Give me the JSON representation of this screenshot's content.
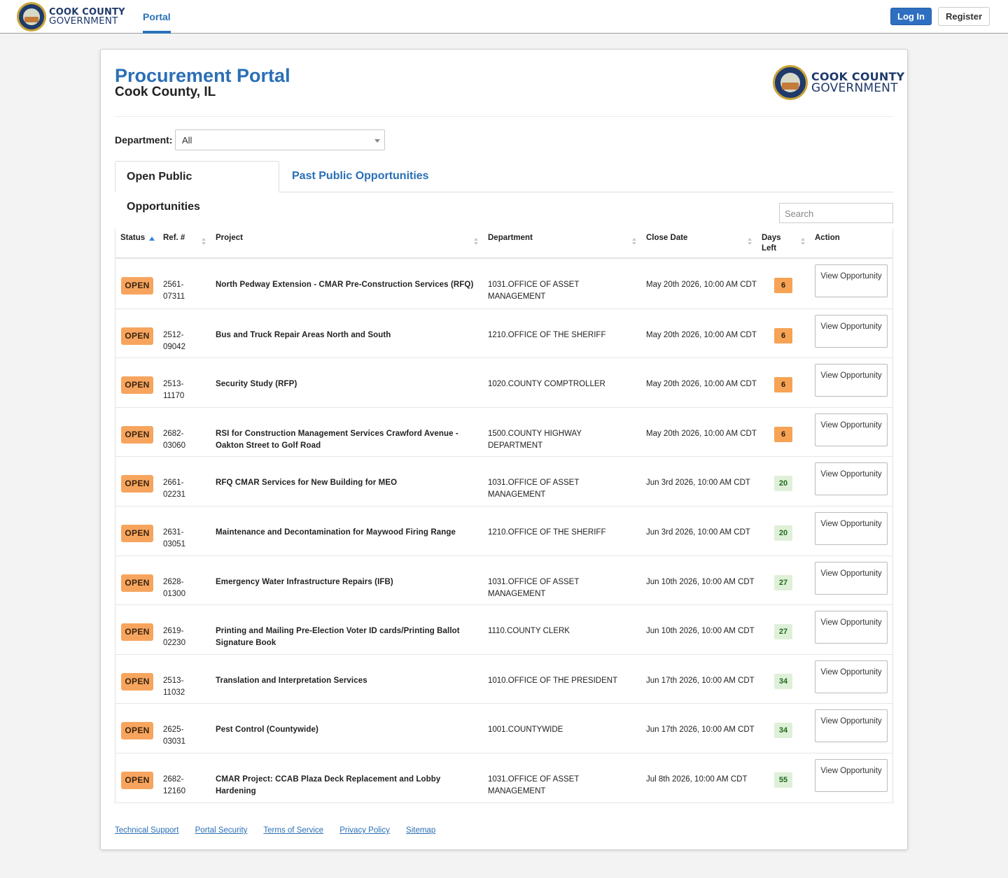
{
  "nav": {
    "brand_line1": "COOK COUNTY",
    "brand_line2": "GOVERNMENT",
    "portal_label": "Portal",
    "login_label": "Log In",
    "register_label": "Register"
  },
  "header": {
    "title": "Procurement Portal",
    "subtitle": "Cook County, IL",
    "logo_line1": "COOK COUNTY",
    "logo_line2": "GOVERNMENT"
  },
  "filter": {
    "department_label": "Department:",
    "department_value": "All"
  },
  "tabs": [
    {
      "label": "Open Public Opportunities",
      "active": true
    },
    {
      "label": "Past Public Opportunities",
      "active": false
    }
  ],
  "search": {
    "placeholder": "Search"
  },
  "table": {
    "columns": [
      "Status",
      "Ref. #",
      "Project",
      "Department",
      "Close Date",
      "Days Left",
      "Action"
    ],
    "rows": [
      {
        "status": "OPEN",
        "ref": "2561-07311",
        "project": "North Pedway Extension - CMAR Pre-Construction Services (RFQ)",
        "department": "1031.OFFICE OF ASSET MANAGEMENT",
        "close_date": "May 20th 2026, 10:00 AM CDT",
        "days_left": "6",
        "days_status": "warn",
        "action": "View Opportunity"
      },
      {
        "status": "OPEN",
        "ref": "2512-09042",
        "project": "Bus and Truck Repair Areas North and South",
        "department": "1210.OFFICE OF THE SHERIFF",
        "close_date": "May 20th 2026, 10:00 AM CDT",
        "days_left": "6",
        "days_status": "warn",
        "action": "View Opportunity"
      },
      {
        "status": "OPEN",
        "ref": "2513-11170",
        "project": "Security Study (RFP)",
        "department": "1020.COUNTY COMPTROLLER",
        "close_date": "May 20th 2026, 10:00 AM CDT",
        "days_left": "6",
        "days_status": "warn",
        "action": "View Opportunity"
      },
      {
        "status": "OPEN",
        "ref": "2682-03060",
        "project": "RSI for Construction Management Services Crawford Avenue - Oakton Street to Golf Road",
        "department": "1500.COUNTY HIGHWAY DEPARTMENT",
        "close_date": "May 20th 2026, 10:00 AM CDT",
        "days_left": "6",
        "days_status": "warn",
        "action": "View Opportunity"
      },
      {
        "status": "OPEN",
        "ref": "2661-02231",
        "project": "RFQ CMAR Services for New Building for MEO",
        "department": "1031.OFFICE OF ASSET MANAGEMENT",
        "close_date": "Jun 3rd 2026, 10:00 AM CDT",
        "days_left": "20",
        "days_status": "ok",
        "action": "View Opportunity"
      },
      {
        "status": "OPEN",
        "ref": "2631-03051",
        "project": "Maintenance and Decontamination for Maywood Firing Range",
        "department": "1210.OFFICE OF THE SHERIFF",
        "close_date": "Jun 3rd 2026, 10:00 AM CDT",
        "days_left": "20",
        "days_status": "ok",
        "action": "View Opportunity"
      },
      {
        "status": "OPEN",
        "ref": "2628-01300",
        "project": "Emergency Water Infrastructure Repairs (IFB)",
        "department": "1031.OFFICE OF ASSET MANAGEMENT",
        "close_date": "Jun 10th 2026, 10:00 AM CDT",
        "days_left": "27",
        "days_status": "ok",
        "action": "View Opportunity"
      },
      {
        "status": "OPEN",
        "ref": "2619-02230",
        "project": "Printing and Mailing Pre-Election Voter ID cards/Printing Ballot Signature Book",
        "department": "1110.COUNTY CLERK",
        "close_date": "Jun 10th 2026, 10:00 AM CDT",
        "days_left": "27",
        "days_status": "ok",
        "action": "View Opportunity"
      },
      {
        "status": "OPEN",
        "ref": "2513-11032",
        "project": "Translation and Interpretation Services",
        "department": "1010.OFFICE OF THE PRESIDENT",
        "close_date": "Jun 17th 2026, 10:00 AM CDT",
        "days_left": "34",
        "days_status": "ok",
        "action": "View Opportunity"
      },
      {
        "status": "OPEN",
        "ref": "2625-03031",
        "project": "Pest Control (Countywide)",
        "department": "1001.COUNTYWIDE",
        "close_date": "Jun 17th 2026, 10:00 AM CDT",
        "days_left": "34",
        "days_status": "ok",
        "action": "View Opportunity"
      },
      {
        "status": "OPEN",
        "ref": "2682-12160",
        "project": "CMAR Project: CCAB Plaza Deck Replacement and Lobby Hardening",
        "department": "1031.OFFICE OF ASSET MANAGEMENT",
        "close_date": "Jul 8th 2026, 10:00 AM CDT",
        "days_left": "55",
        "days_status": "ok",
        "action": "View Opportunity"
      }
    ]
  },
  "footer": {
    "links": [
      "Technical Support",
      "Portal Security",
      "Terms of Service",
      "Privacy Policy",
      "Sitemap"
    ]
  },
  "colors": {
    "accent": "#2a6fb5",
    "open_badge": "#f7a55e",
    "days_warn": "#f6a356",
    "days_ok": "#dff0d8"
  }
}
